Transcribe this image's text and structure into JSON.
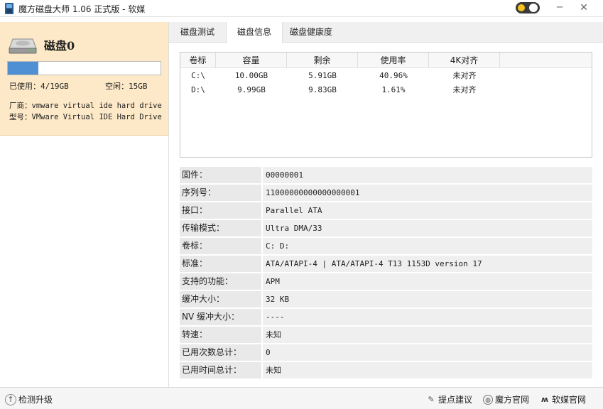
{
  "window": {
    "title": "魔方磁盘大师 1.06 正式版 - 软媒",
    "minimize_glyph": "−",
    "close_glyph": "✕"
  },
  "disk": {
    "name": "磁盘0",
    "usage_fraction": 0.2,
    "used_label": "已使用：4/19GB",
    "free_label": "空闲：15GB",
    "vendor_label": "厂商：vmware virtual ide hard drive",
    "model_label": "型号：VMware Virtual IDE Hard Drive"
  },
  "tabs": [
    {
      "label": "磁盘测试"
    },
    {
      "label": "磁盘信息"
    },
    {
      "label": "磁盘健康度"
    }
  ],
  "partition_table": {
    "headers": [
      "卷标",
      "容量",
      "剩余",
      "使用率",
      "4K对齐"
    ],
    "rows": [
      {
        "volume": "C:\\",
        "capacity": "10.00GB",
        "remaining": "5.91GB",
        "usage": "40.96%",
        "align": "未对齐"
      },
      {
        "volume": "D:\\",
        "capacity": "9.99GB",
        "remaining": "9.83GB",
        "usage": "1.61%",
        "align": "未对齐"
      }
    ]
  },
  "info": [
    {
      "label": "固件：",
      "value": "00000001"
    },
    {
      "label": "序列号：",
      "value": "11000000000000000001"
    },
    {
      "label": "接口：",
      "value": "Parallel ATA"
    },
    {
      "label": "传输模式：",
      "value": "Ultra DMA/33"
    },
    {
      "label": "卷标：",
      "value": "C: D:"
    },
    {
      "label": "标准：",
      "value": "ATA/ATAPI-4 | ATA/ATAPI-4 T13 1153D version 17"
    },
    {
      "label": "支持的功能：",
      "value": "APM"
    },
    {
      "label": "缓冲大小：",
      "value": "32 KB"
    },
    {
      "label": "NV 缓冲大小：",
      "value": "----"
    },
    {
      "label": "转速：",
      "value": "未知"
    },
    {
      "label": "已用次数总计：",
      "value": "0"
    },
    {
      "label": "已用时间总计：",
      "value": "未知"
    }
  ],
  "footer": {
    "upgrade_label": "检测升级",
    "links": [
      {
        "label": "提点建议",
        "icon": "pen-icon"
      },
      {
        "label": "魔方官网",
        "icon": "globe-icon"
      },
      {
        "label": "软媒官网",
        "icon": "ruanmei-logo-icon"
      }
    ]
  },
  "colors": {
    "usage_fill": "#4f8fd4",
    "disk_card_bg": "#fde9c7",
    "toggle_sun": "#f6c21c"
  }
}
